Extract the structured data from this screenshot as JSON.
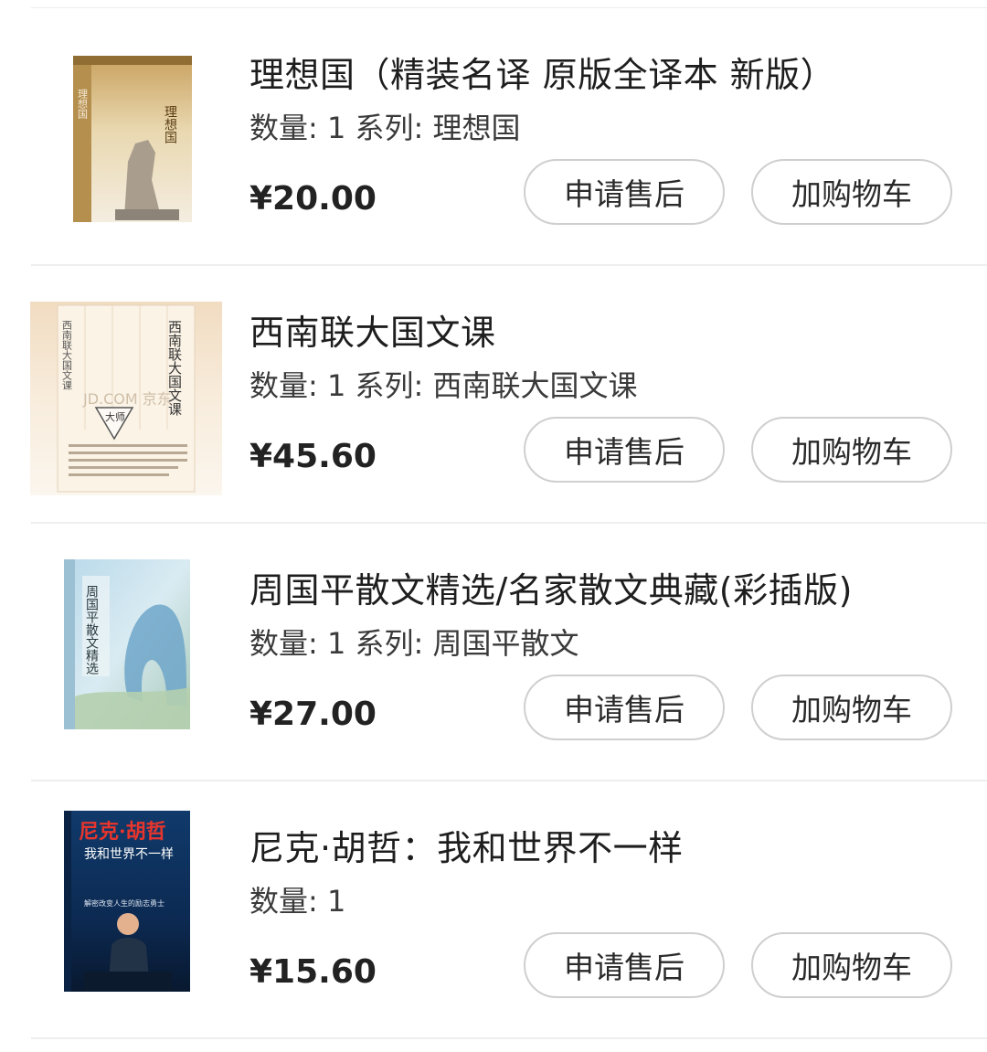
{
  "orders": [
    {
      "title": "理想国（精装名译 原版全译本 新版）",
      "meta": "数量: 1 系列: 理想国",
      "price": "¥20.00",
      "cover_icon": "book-cover-republic"
    },
    {
      "title": "西南联大国文课",
      "meta": "数量: 1 系列: 西南联大国文课",
      "price": "¥45.60",
      "cover_icon": "book-cover-xinan",
      "cover_text": {
        "title": "西南联大国文课",
        "watermark": "JD.COM 京东",
        "badge": "大师"
      }
    },
    {
      "title": "周国平散文精选/名家散文典藏(彩插版)",
      "meta": "数量: 1 系列: 周国平散文",
      "price": "¥27.00",
      "cover_icon": "book-cover-zhouguoping",
      "cover_text": {
        "title": "周国平散文精选"
      }
    },
    {
      "title": "尼克·胡哲：我和世界不一样",
      "meta": "数量: 1",
      "price": "¥15.60",
      "cover_icon": "book-cover-nick",
      "cover_text": {
        "title": "尼克·胡哲",
        "subtitle": "我和世界不一样",
        "tagline": "解密改变人生的励志勇士"
      }
    }
  ],
  "buttons": {
    "after_sales": "申请售后",
    "add_to_cart": "加购物车"
  },
  "cover1_text": {
    "title": "理想国"
  },
  "colors": {
    "divider": "#eeeeee",
    "button_border": "#cfcfcf",
    "text": "#222222"
  }
}
